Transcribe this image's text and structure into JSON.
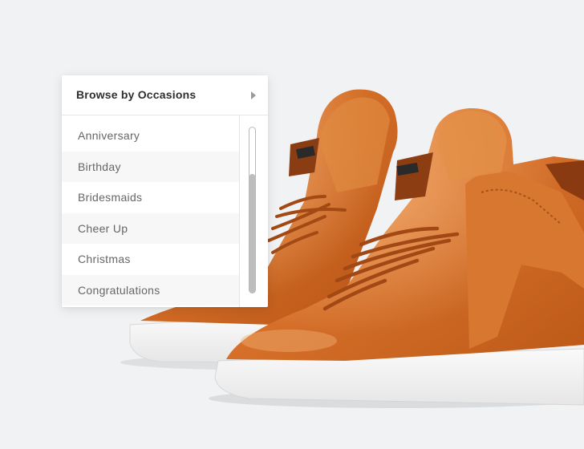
{
  "dropdown": {
    "title": "Browse by Occasions",
    "items": [
      {
        "label": "Anniversary"
      },
      {
        "label": "Birthday"
      },
      {
        "label": "Bridesmaids"
      },
      {
        "label": "Cheer Up"
      },
      {
        "label": "Christmas"
      },
      {
        "label": "Congratulations"
      }
    ]
  },
  "icons": {
    "header_arrow": "caret-right-icon"
  },
  "colors": {
    "background": "#f1f2f4",
    "leather": "#d6702b",
    "sole": "#f4f4f2"
  }
}
